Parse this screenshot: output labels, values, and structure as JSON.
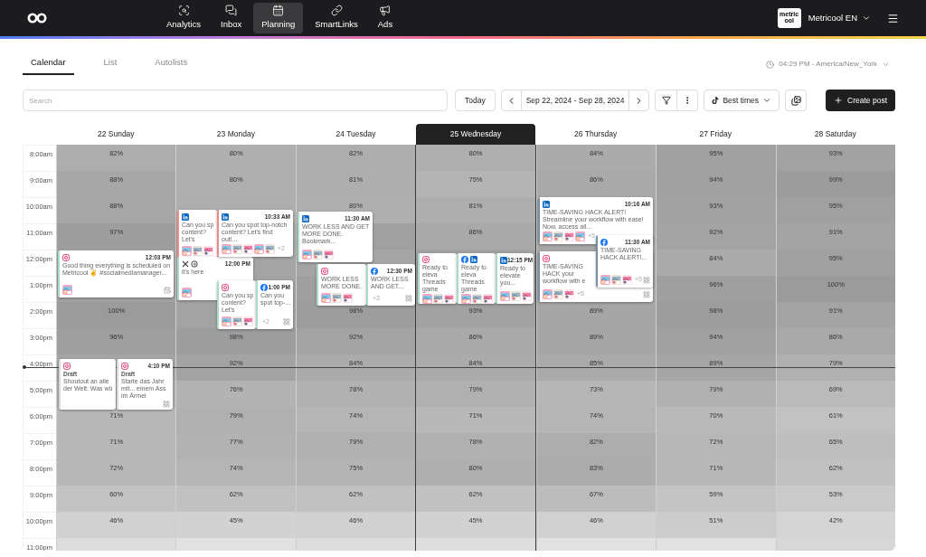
{
  "nav": {
    "items": [
      {
        "label": "Analytics",
        "selected": false
      },
      {
        "label": "Inbox",
        "selected": false
      },
      {
        "label": "Planning",
        "selected": true
      },
      {
        "label": "SmartLinks",
        "selected": false
      },
      {
        "label": "Ads",
        "selected": false
      }
    ],
    "brand_badge": "metricool",
    "account": "Metricool EN"
  },
  "tabs": [
    {
      "label": "Calendar",
      "selected": true
    },
    {
      "label": "List",
      "selected": false
    },
    {
      "label": "Autolists",
      "selected": false
    }
  ],
  "timezone": "04:29 PM - America/New_York",
  "toolbar": {
    "search": {
      "placeholder": "Search"
    },
    "today": "Today",
    "date_range": "Sep 22, 2024 - Sep 28, 2024",
    "best_times": "Best times",
    "create": "Create post"
  },
  "days": [
    {
      "label": "22 Sunday",
      "selected": false
    },
    {
      "label": "23 Monday",
      "selected": false
    },
    {
      "label": "24 Tuesday",
      "selected": false
    },
    {
      "label": "25 Wednesday",
      "selected": true
    },
    {
      "label": "26 Thursday",
      "selected": false
    },
    {
      "label": "27 Friday",
      "selected": false
    },
    {
      "label": "28 Saturday",
      "selected": false
    }
  ],
  "heatmap": {
    "rows": [
      {
        "label": "8:00am",
        "cells": [
          {
            "text": "82%",
            "color": "#adadad"
          },
          {
            "text": "80%",
            "color": "#afafaf"
          },
          {
            "text": "82%",
            "color": "#adadad"
          },
          {
            "text": "80%",
            "color": "#afafaf"
          },
          {
            "text": "84%",
            "color": "#ababab"
          },
          {
            "text": "95%",
            "color": "#a0a0a0"
          },
          {
            "text": "93%",
            "color": "#a2a2a2"
          }
        ]
      },
      {
        "label": "9:00am",
        "cells": [
          {
            "text": "88%",
            "color": "#a7a7a7"
          },
          {
            "text": "80%",
            "color": "#afafaf"
          },
          {
            "text": "81%",
            "color": "#aeaeae"
          },
          {
            "text": "75%",
            "color": "#b4b4b4"
          },
          {
            "text": "86%",
            "color": "#a9a9a9"
          },
          {
            "text": "94%",
            "color": "#a1a1a1"
          },
          {
            "text": "99%",
            "color": "#9c9c9c"
          }
        ]
      },
      {
        "label": "10:00am",
        "cells": [
          {
            "text": "88%",
            "color": "#a7a7a7"
          },
          {
            "color": "#aeaeae"
          },
          {
            "text": "80%",
            "color": "#afafaf"
          },
          {
            "text": "81%",
            "color": "#aeaeae"
          },
          {
            "color": "#a9a9a9"
          },
          {
            "text": "93%",
            "color": "#a2a2a2"
          },
          {
            "text": "95%",
            "color": "#a0a0a0"
          }
        ]
      },
      {
        "label": "11:00am",
        "cells": [
          {
            "text": "97%",
            "color": "#9e9e9e"
          },
          {
            "color": "#a5a5a5"
          },
          {
            "color": "#a0a0a0"
          },
          {
            "text": "86%",
            "color": "#a9a9a9"
          },
          {
            "color": "#a7a7a7"
          },
          {
            "text": "92%",
            "color": "#a3a3a3"
          },
          {
            "text": "91%",
            "color": "#a4a4a4"
          }
        ]
      },
      {
        "label": "12:00pm",
        "cells": [
          {
            "color": "#a5a5a5"
          },
          {
            "color": "#a5a5a5"
          },
          {
            "color": "#a5a5a5"
          },
          {
            "color": "#a2a2a2"
          },
          {
            "color": "#a7a7a7"
          },
          {
            "text": "84%",
            "color": "#ababab"
          },
          {
            "text": "95%",
            "color": "#a0a0a0"
          }
        ]
      },
      {
        "label": "1:00pm",
        "cells": [
          {
            "color": "#a2a2a2"
          },
          {
            "color": "#a3a3a3"
          },
          {
            "color": "#9f9f9f"
          },
          {
            "color": "#a5a5a5"
          },
          {},
          {
            "text": "96%",
            "color": "#9f9f9f"
          },
          {
            "text": "100%",
            "color": "#9b9b9b"
          }
        ]
      },
      {
        "label": "2:00pm",
        "cells": [
          {
            "text": "100%",
            "color": "#9b9b9b"
          },
          {},
          {
            "text": "98%",
            "color": "#9d9d9d"
          },
          {
            "text": "93%",
            "color": "#a2a2a2"
          },
          {
            "text": "89%",
            "color": "#a6a6a6"
          },
          {
            "text": "98%",
            "color": "#9d9d9d"
          },
          {
            "text": "91%",
            "color": "#a4a4a4"
          }
        ]
      },
      {
        "label": "3:00pm",
        "cells": [
          {
            "text": "96%",
            "color": "#9f9f9f"
          },
          {
            "text": "98%",
            "color": "#9d9d9d"
          },
          {
            "text": "92%",
            "color": "#a3a3a3"
          },
          {
            "text": "86%",
            "color": "#a9a9a9"
          },
          {
            "text": "89%",
            "color": "#a6a6a6"
          },
          {
            "text": "94%",
            "color": "#a1a1a1"
          },
          {
            "text": "86%",
            "color": "#a9a9a9"
          }
        ]
      },
      {
        "label": "4:00pm",
        "cells": [
          {
            "color": "#a5a5a5"
          },
          {
            "text": "92%",
            "color": "#a3a3a3"
          },
          {
            "text": "84%",
            "color": "#ababab"
          },
          {
            "text": "84%",
            "color": "#ababab"
          },
          {
            "text": "85%",
            "color": "#aaaaaa"
          },
          {
            "text": "89%",
            "color": "#a6a6a6"
          },
          {
            "text": "79%",
            "color": "#b0b0b0"
          }
        ]
      },
      {
        "label": "5:00pm",
        "cells": [
          {
            "color": "#afafaf"
          },
          {
            "text": "76%",
            "color": "#b3b3b3"
          },
          {
            "text": "78%",
            "color": "#b1b1b1"
          },
          {
            "text": "79%",
            "color": "#b0b0b0"
          },
          {
            "text": "73%",
            "color": "#b6b6b6"
          },
          {
            "text": "79%",
            "color": "#b0b0b0"
          },
          {
            "text": "69%",
            "color": "#bababa"
          }
        ]
      },
      {
        "label": "6:00pm",
        "cells": [
          {
            "text": "71%",
            "color": "#b8b8b8"
          },
          {
            "text": "79%",
            "color": "#b0b0b0"
          },
          {
            "text": "74%",
            "color": "#b5b5b5"
          },
          {
            "text": "71%",
            "color": "#b8b8b8"
          },
          {
            "text": "74%",
            "color": "#b5b5b5"
          },
          {
            "text": "70%",
            "color": "#b9b9b9"
          },
          {
            "text": "61%",
            "color": "#c2c2c2"
          }
        ]
      },
      {
        "label": "7:00pm",
        "cells": [
          {
            "text": "71%",
            "color": "#b8b8b8"
          },
          {
            "text": "77%",
            "color": "#b2b2b2"
          },
          {
            "text": "79%",
            "color": "#b0b0b0"
          },
          {
            "text": "78%",
            "color": "#b1b1b1"
          },
          {
            "text": "82%",
            "color": "#adadad"
          },
          {
            "text": "72%",
            "color": "#b7b7b7"
          },
          {
            "text": "65%",
            "color": "#bebebe"
          }
        ]
      },
      {
        "label": "8:00pm",
        "cells": [
          {
            "text": "72%",
            "color": "#b7b7b7"
          },
          {
            "text": "74%",
            "color": "#b5b5b5"
          },
          {
            "text": "75%",
            "color": "#b4b4b4"
          },
          {
            "text": "80%",
            "color": "#afafaf"
          },
          {
            "text": "83%",
            "color": "#acacac"
          },
          {
            "text": "71%",
            "color": "#b8b8b8"
          },
          {
            "text": "62%",
            "color": "#c1c1c1"
          }
        ]
      },
      {
        "label": "9:00pm",
        "cells": [
          {
            "text": "60%",
            "color": "#c3c3c3"
          },
          {
            "text": "62%",
            "color": "#c1c1c1"
          },
          {
            "text": "62%",
            "color": "#c1c1c1"
          },
          {
            "text": "62%",
            "color": "#c1c1c1"
          },
          {
            "text": "67%",
            "color": "#bcbcbc"
          },
          {
            "text": "59%",
            "color": "#c4c4c4"
          },
          {
            "text": "53%",
            "color": "#cacaca"
          }
        ]
      },
      {
        "label": "10:00pm",
        "cells": [
          {
            "text": "46%",
            "color": "#d1d1d1"
          },
          {
            "text": "45%",
            "color": "#d2d2d2"
          },
          {
            "text": "46%",
            "color": "#d1d1d1"
          },
          {
            "text": "45%",
            "color": "#d2d2d2"
          },
          {
            "text": "46%",
            "color": "#d1d1d1"
          },
          {
            "text": "51%",
            "color": "#cccccc"
          },
          {
            "text": "42%",
            "color": "#d5d5d5"
          }
        ]
      },
      {
        "label": "11:00pm",
        "cells": [
          {
            "color": "#dcdcdc"
          },
          {
            "color": "#e1e1e1"
          },
          {
            "color": "#dddddd"
          },
          {
            "color": "#dedede"
          },
          {
            "color": "#e1e1e1"
          },
          {
            "color": "#e1e1e1"
          },
          {
            "color": "#d7d7d7"
          }
        ]
      }
    ]
  },
  "posts": [
    {
      "networks": [
        {
          "kind": "instagram"
        }
      ],
      "time": "12:03 PM",
      "text": "Good thing everything is scheduled on Metricool ✌ #socialmediamanager...",
      "thumbnails": [
        {
          "kind": "picture"
        }
      ],
      "color": "#a8dcc9"
    },
    {
      "networks": [
        {
          "kind": "instagram"
        }
      ],
      "status": "Draft",
      "text": "Shoutout an alle der Welt: Was wü",
      "color": "#d9d9d9"
    },
    {
      "networks": [
        {
          "kind": "instagram"
        }
      ],
      "time": "4:10 PM",
      "status": "Draft",
      "text": "Starte das Jahr mit... einem Ass im Ärmel",
      "color": "#d9d9d9"
    },
    {
      "networks": [
        {
          "kind": "linkedin"
        }
      ],
      "text": "Can you sp content? Let's",
      "thumbnails": [
        {
          "kind": "picture"
        },
        {
          "kind": "picture"
        },
        {
          "kind": "picture"
        }
      ],
      "color": "#ee8a8a"
    },
    {
      "networks": [
        {
          "kind": "x"
        },
        {
          "kind": "threads"
        }
      ],
      "time": "12:00 PM",
      "text": "it's here",
      "thumbnails": [
        {
          "kind": "picture"
        }
      ],
      "color": "#a8dcc9"
    },
    {
      "networks": [
        {
          "kind": "linkedin"
        }
      ],
      "time": "10:33 AM",
      "text": "Can you spot top-notch content? Let's find out!...",
      "thumbnails": [
        {
          "kind": "picture"
        },
        {
          "kind": "picture"
        },
        {
          "kind": "picture"
        },
        {
          "kind": "picture"
        },
        {
          "kind": "picture"
        }
      ],
      "more": "+2",
      "color": "#ee8a8a"
    },
    {
      "networks": [
        {
          "kind": "instagram"
        }
      ],
      "text": "Can you sp content? Let's",
      "thumbnails": [
        {
          "kind": "picture"
        },
        {
          "kind": "picture"
        },
        {
          "kind": "picture"
        }
      ],
      "color": "#a8dcc9"
    },
    {
      "networks": [
        {
          "kind": "facebook"
        }
      ],
      "time": "1:00 PM",
      "text": "Can you spot top-...",
      "more": "+2",
      "color": "#a8dcc9"
    },
    {
      "networks": [
        {
          "kind": "linkedin"
        }
      ],
      "time": "11:30 AM",
      "text": "WORK LESS AND GET MORE DONE. Bookmark...",
      "thumbnails": [
        {
          "kind": "picture"
        },
        {
          "kind": "picture"
        },
        {
          "kind": "picture"
        }
      ],
      "color": "#a8dcc9"
    },
    {
      "networks": [
        {
          "kind": "instagram"
        }
      ],
      "text": "WORK LESS MORE DONE.",
      "thumbnails": [
        {
          "kind": "picture"
        },
        {
          "kind": "picture"
        },
        {
          "kind": "picture"
        }
      ],
      "color": "#a8dcc9"
    },
    {
      "networks": [
        {
          "kind": "facebook"
        }
      ],
      "time": "12:30 PM",
      "text": "WORK LESS AND GET...",
      "more": "+3",
      "color": "#a8dcc9"
    },
    {
      "networks": [
        {
          "kind": "instagram"
        }
      ],
      "text": "Ready to eleva Threads game",
      "thumbnails": [
        {
          "kind": "picture"
        },
        {
          "kind": "picture"
        },
        {
          "kind": "picture"
        }
      ],
      "color": "#a8dcc9"
    },
    {
      "networks": [
        {
          "kind": "facebook"
        },
        {
          "kind": "linkedin"
        }
      ],
      "text": "Ready to eleva Threads game",
      "thumbnails": [
        {
          "kind": "picture"
        },
        {
          "kind": "picture"
        },
        {
          "kind": "picture"
        }
      ],
      "color": "#a8dcc9"
    },
    {
      "networks": [
        {
          "kind": "linkedin"
        }
      ],
      "time": "12:15 PM",
      "text": "Ready to elevate you...",
      "thumbnails": [
        {
          "kind": "picture"
        },
        {
          "kind": "picture"
        },
        {
          "kind": "picture"
        }
      ],
      "color": "#a8dcc9"
    },
    {
      "networks": [
        {
          "kind": "linkedin"
        }
      ],
      "time": "10:16 AM",
      "text": "TIME-SAVING HACK ALERT! Streamline your workflow with ease! Now, access all...",
      "thumbnails": [
        {
          "kind": "picture"
        },
        {
          "kind": "picture"
        },
        {
          "kind": "picture"
        },
        {
          "kind": "picture"
        }
      ],
      "more": "+5",
      "color": "#7a8ea6"
    },
    {
      "networks": [
        {
          "kind": "instagram"
        }
      ],
      "text": "TIME-SAVING HACK your workflow with e",
      "thumbnails": [
        {
          "kind": "picture"
        },
        {
          "kind": "picture"
        },
        {
          "kind": "picture"
        }
      ],
      "more": "+5",
      "color": "#7a8ea6"
    },
    {
      "networks": [
        {
          "kind": "facebook"
        }
      ],
      "time": "11:30 AM",
      "text": "TIME-SAVING HACK ALERT!...",
      "thumbnails": [
        {
          "kind": "picture"
        },
        {
          "kind": "picture"
        },
        {
          "kind": "picture"
        }
      ],
      "more": "+5",
      "color": "#7a8ea6"
    }
  ]
}
